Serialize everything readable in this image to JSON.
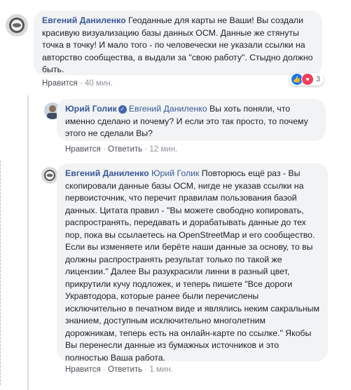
{
  "comments": [
    {
      "author": "Евгений Даниленко",
      "text": "Геоданные для карты не Ваши! Вы создали красивую визуализацию базы данных ОСМ. Данные же стянуты точка в точку! И мало того - по человечески не указали ссылки на авторство сообщества, а выдали за \"свою работу\". Стыдно должно быть.",
      "like": "Нравится",
      "time": "40 мин.",
      "reaction_count": "3"
    },
    {
      "author": "Юрий Голик",
      "tag": "Евгений Даниленко",
      "text": "Вы хоть поняли, что именно сделано и почему? И если это так просто, то почему этого не сделали Вы?",
      "like": "Нравится",
      "reply": "Ответить",
      "time": "12 мин."
    },
    {
      "author": "Евгений Даниленко",
      "tag": "Юрий Голик",
      "text": "Повторюсь ещё раз - Вы скопировали данные базы ОСМ, нигде не указав ссылки на первоисточник, что перечит правилам пользования базой данных. Цитата правил - \"Вы можете свободно копировать, распространять, передавать и дорабатывать данные до тех пор, пока вы ссылаетесь на OpenStreetMap и его сообщество. Если вы изменяете или берёте наши данные за основу, то вы должны распространять результат только по такой же лицензии.\" Далее Вы разукрасили линни в разный цвет, прикрутили кучу подложек, и теперь пишете \"Все дороги Укравтодора, которые ранее были перечислены исключительно в печатном виде и являлись неким сакральным знанием, доступным исключительно многолетним дорожникам, теперь есть на онлайн-карте по ссылке.\" Якобы Вы перенесли данные из бумажных источников и это полностью Ваша работа.",
      "like": "Нравится",
      "reply": "Ответить",
      "time": "1 мин."
    }
  ],
  "separator": "·",
  "colors": {
    "link": "#385898",
    "bubble": "#f2f3f5",
    "like_blue": "#1877f2",
    "love_red": "#f33e58"
  }
}
